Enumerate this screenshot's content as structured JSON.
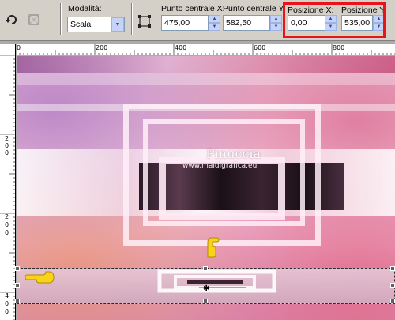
{
  "toolbar": {
    "mode_label": "Modalità:",
    "mode_value": "Scala",
    "center_x_label": "Punto centrale X:",
    "center_x_value": "475,00",
    "center_y_label": "Punto centrale Y:",
    "center_y_value": "582,50",
    "pos_x_label": "Posizione X:",
    "pos_x_value": "0,00",
    "pos_y_label": "Posizione Y:",
    "pos_y_value": "535,00"
  },
  "ruler": {
    "top_labels": [
      "0",
      "200",
      "400",
      "600",
      "800"
    ],
    "left_labels": [
      "2",
      "0",
      "0",
      "2",
      "0",
      "0",
      "4",
      "0",
      "0",
      "6",
      "0"
    ]
  },
  "watermark": {
    "title": "Pinuccia",
    "url": "www.maidigrafica.eu"
  },
  "colors": {
    "highlight": "#e8141c",
    "toolbar": "#d4d0c8"
  },
  "icons": [
    "rotate-icon",
    "deform-icon",
    "center-point-icon",
    "pointing-hand-icon"
  ]
}
